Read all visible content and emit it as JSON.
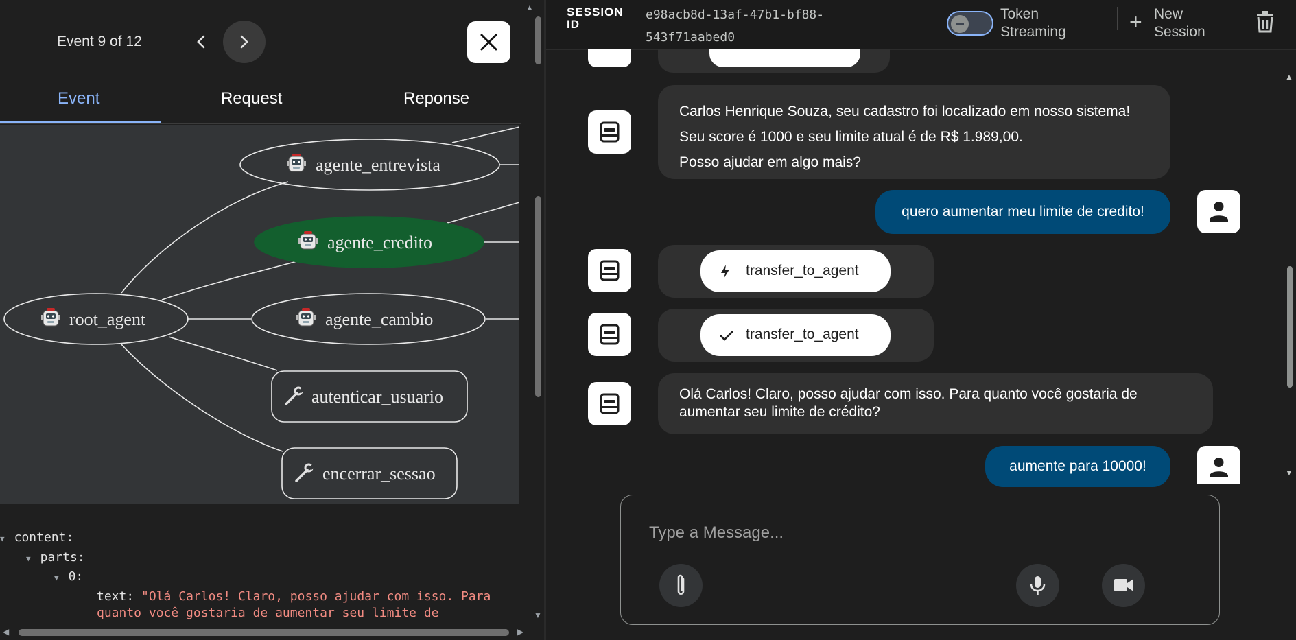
{
  "event_panel": {
    "event_count": "Event 9 of 12",
    "tabs": [
      {
        "label": "Event",
        "active": true
      },
      {
        "label": "Request",
        "active": false
      },
      {
        "label": "Reponse",
        "active": false
      }
    ],
    "graph": {
      "nodes": [
        {
          "label": "agente_entrevista",
          "kind": "agent",
          "active": false
        },
        {
          "label": "agente_credito",
          "kind": "agent",
          "active": true
        },
        {
          "label": "root_agent",
          "kind": "agent",
          "active": false
        },
        {
          "label": "agente_cambio",
          "kind": "agent",
          "active": false
        },
        {
          "label": "autenticar_usuario",
          "kind": "tool",
          "active": false
        },
        {
          "label": "encerrar_sessao",
          "kind": "tool",
          "active": false
        }
      ],
      "active_color": "#135f2e"
    },
    "yaml": {
      "content_key": "content",
      "parts_key": "parts",
      "index_key": "0",
      "text_key": "text",
      "text_value_line1": "\"Olá Carlos! Claro, posso ajudar com isso. Para",
      "text_value_line2": "quanto você gostaria de aumentar seu limite de"
    }
  },
  "session": {
    "label": "SESSION ID",
    "id_line1": "e98acb8d-13af-47b1-bf88-",
    "id_line2": "543f71aabed0",
    "token_streaming_line1": "Token",
    "token_streaming_line2": "Streaming",
    "token_streaming_on": false,
    "new_session_line1": "New",
    "new_session_line2": "Session"
  },
  "chat": {
    "messages": [
      {
        "role": "bot",
        "type": "text",
        "lines": [
          "Carlos Henrique Souza, seu cadastro foi localizado em nosso sistema!",
          "Seu score é 1000 e seu limite atual é de R$ 1.989,00.",
          "Posso ajudar em algo mais?"
        ]
      },
      {
        "role": "user",
        "type": "text",
        "text": "quero aumentar meu limite de credito!"
      },
      {
        "role": "bot",
        "type": "function_call",
        "name": "transfer_to_agent",
        "icon": "bolt-icon"
      },
      {
        "role": "bot",
        "type": "function_response",
        "name": "transfer_to_agent",
        "icon": "check-icon"
      },
      {
        "role": "bot",
        "type": "text",
        "lines": [
          "Olá Carlos! Claro, posso ajudar com isso. Para quanto você gostaria de",
          "aumentar seu limite de crédito?"
        ]
      },
      {
        "role": "user",
        "type": "text",
        "text": "aumente para 10000!"
      }
    ],
    "input_placeholder": "Type a Message...",
    "user_bubble_color": "#004a77"
  }
}
